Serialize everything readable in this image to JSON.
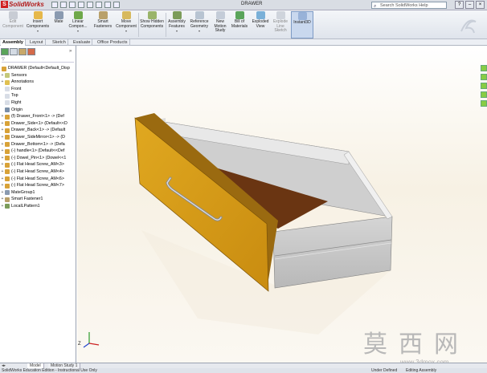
{
  "app": {
    "brand": "SolidWorks",
    "document_title": "DRAWER"
  },
  "help_search": {
    "placeholder": "Search SolidWorks Help"
  },
  "toolbar": {
    "edit_component": "Edit Component",
    "insert_components": "Insert Components",
    "mate": "Mate",
    "linear_component": "Linear Compon...",
    "smart_fasteners": "Smart Fasteners",
    "move_component": "Move Component",
    "show_hidden": "Show Hidden Components",
    "assembly_features": "Assembly Features",
    "reference_geometry": "Reference Geometry",
    "new_motion_study": "New Motion Study",
    "bill_of_materials": "Bill of Materials",
    "exploded_view": "Exploded View",
    "explode_line_sketch": "Explode Line Sketch",
    "instant3d": "Instant3D"
  },
  "command_tabs": [
    "Assembly",
    "Layout",
    "Sketch",
    "Evaluate",
    "Office Products"
  ],
  "tree": {
    "root": "DRAWER  (Default<Default_Disp",
    "items": [
      "Sensors",
      "Annotations",
      "Front",
      "Top",
      "Right",
      "Origin",
      "(f) Drawer_Front<1> -> (Def",
      "Drawer_Side<1> (Default<<D",
      "Drawer_Back<1> -> (Default",
      "Drawer_SideMirror<1> -> (D",
      "Drawer_Bottom<1> -> (Defa",
      "(-) handle<1> (Default<<Def",
      "(-) Dowel_Pin<1> (Dowel<<1",
      "(-) Flat Head Screw_AM<3>",
      "(-) Flat Head Screw_AM<4>",
      "(-) Flat Head Screw_AM<6>",
      "(-) Flat Head Screw_AM<7>",
      "MateGroup1",
      "Smart Fastener1",
      "LocalLPattern1"
    ]
  },
  "bottom_tabs": [
    "Model",
    "Motion Study 1"
  ],
  "status": {
    "left": "SolidWorks Education Edition - Instructional Use Only",
    "state": "Under Defined",
    "mode": "Editing Assembly"
  },
  "watermark": {
    "chinese": "莫西网",
    "url": "www.3dmox.com"
  },
  "colors": {
    "drawer_front": "#d89a1a",
    "drawer_body": "#c9c9c9",
    "drawer_bottom": "#6a3512",
    "brand_red": "#c81e1e"
  }
}
